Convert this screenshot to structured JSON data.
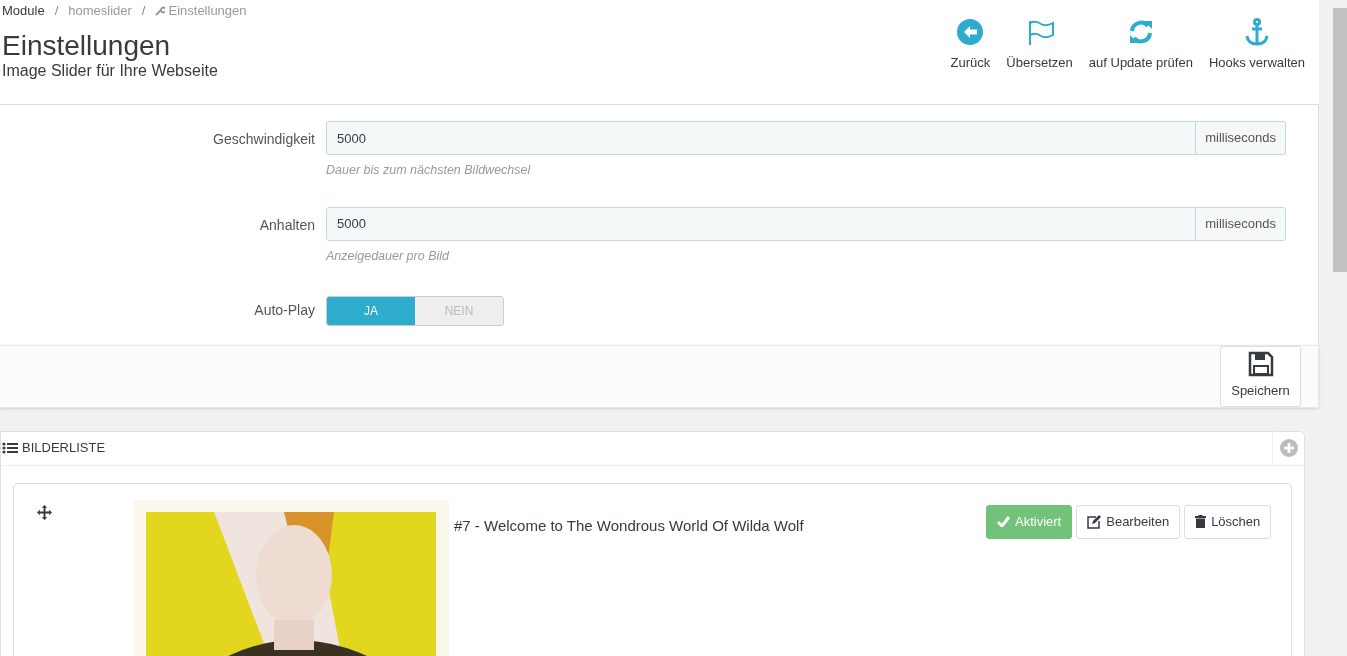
{
  "breadcrumb_separator": "/",
  "breadcrumb": [
    {
      "label": "Module",
      "kind": "root"
    },
    {
      "label": "homeslider",
      "kind": "link"
    },
    {
      "label": "Einstellungen",
      "kind": "current"
    }
  ],
  "title": "Einstellungen",
  "subtitle": "Image Slider für Ihre Webseite",
  "toolbar": [
    {
      "label": "Zurück"
    },
    {
      "label": "Übersetzen"
    },
    {
      "label": "auf Update prüfen"
    },
    {
      "label": "Hooks verwalten"
    }
  ],
  "fields": [
    {
      "label": "Geschwindigkeit",
      "value": "5000",
      "unit": "milliseconds",
      "help": "Dauer bis zum nächsten Bildwechsel"
    },
    {
      "label": "Anhalten",
      "value": "5000",
      "unit": "milliseconds",
      "help": "Anzeigedauer pro Bild"
    }
  ],
  "autoplay": {
    "label": "Auto-Play",
    "options": [
      {
        "label": "JA",
        "selected": true
      },
      {
        "label": "NEIN",
        "selected": false
      }
    ]
  },
  "save_button": "Speichern",
  "image_list": {
    "title": "BILDERLISTE",
    "items": [
      {
        "title": "#7 - Welcome to The Wondrous World Of Wilda Wolf",
        "active": true,
        "status_label": "Aktiviert",
        "edit_label": "Bearbeiten",
        "delete_label": "Löschen"
      }
    ]
  }
}
